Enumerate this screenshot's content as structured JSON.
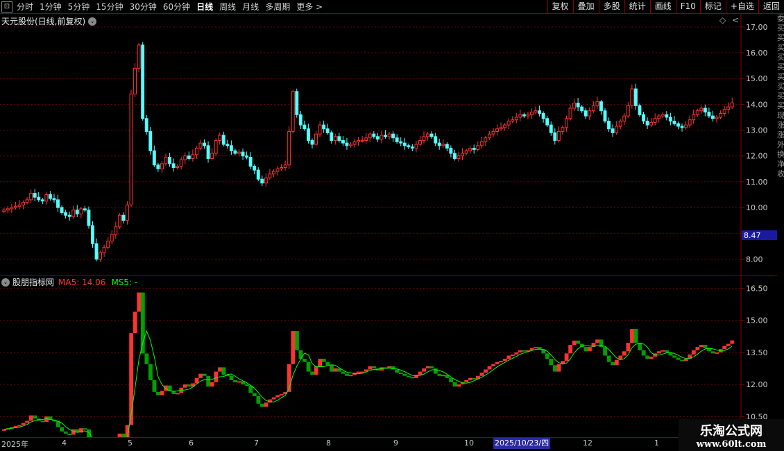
{
  "toolbar": {
    "win_icon": "⊡",
    "periods": [
      "分时",
      "1分钟",
      "5分钟",
      "15分钟",
      "30分钟",
      "60分钟",
      "日线",
      "周线",
      "月线",
      "多周期",
      "更多 >"
    ],
    "active_period": "日线",
    "tools": [
      "复权",
      "叠加",
      "多股",
      "统计",
      "画线",
      "F10",
      "标记",
      "+自选",
      "返回"
    ]
  },
  "main_panel": {
    "title": "天元股份(日线,前复权)",
    "collapse_icon": "chevron-down-icon",
    "diamond_icon": "◇",
    "scroll_icon": "<",
    "y_ticks": [
      "17.00",
      "16.00",
      "15.00",
      "14.00",
      "13.00",
      "12.00",
      "11.00",
      "10.00",
      "9.00",
      "8.00"
    ],
    "price_tag": "8.47"
  },
  "indicator_panel": {
    "title": "股朋指标网",
    "ma5_label": "MA5: 14.06",
    "ms5_label": "MS5: -",
    "y_ticks": [
      "16.50",
      "15.00",
      "13.50",
      "12.00",
      "10.50"
    ]
  },
  "side_col": {
    "text": "委买买买买买买买买买现涨涨外换净收"
  },
  "date_axis": {
    "labels": [
      "2025年",
      "4",
      "5",
      "6",
      "7",
      "8",
      "9",
      "10",
      "2025/10/23/四",
      "12",
      "1"
    ]
  },
  "watermark": {
    "title": "乐淘公式网",
    "url": "www.60lt.com"
  },
  "colors": {
    "up": "#ff3232",
    "down": "#54ffff",
    "ind_down": "#00a000",
    "ma_line": "#00ff00",
    "grid": "#7a0000",
    "axis_text": "#c8c8c8"
  },
  "chart_data": {
    "type": "candlestick",
    "ylim_main": [
      7.5,
      17.4
    ],
    "ylim_indicator": [
      9.6,
      17.0
    ],
    "closes": [
      9.9,
      9.95,
      10.0,
      10.05,
      10.1,
      10.2,
      10.3,
      10.55,
      10.4,
      10.3,
      10.25,
      10.5,
      10.35,
      10.3,
      10.0,
      9.8,
      9.7,
      9.65,
      9.9,
      9.75,
      9.95,
      9.9,
      9.3,
      8.6,
      8.0,
      8.25,
      8.45,
      8.7,
      8.95,
      9.25,
      9.7,
      9.5,
      10.1,
      14.4,
      15.4,
      16.3,
      13.45,
      12.95,
      12.2,
      11.65,
      11.5,
      11.7,
      11.95,
      11.7,
      11.55,
      11.6,
      11.85,
      12.0,
      11.9,
      12.05,
      12.3,
      12.5,
      12.4,
      11.9,
      12.1,
      12.6,
      12.8,
      12.45,
      12.4,
      12.2,
      12.1,
      12.15,
      12.0,
      11.95,
      11.6,
      11.45,
      11.1,
      10.95,
      11.15,
      11.3,
      11.4,
      11.5,
      11.55,
      11.65,
      12.95,
      14.5,
      13.6,
      13.2,
      13.05,
      12.6,
      12.45,
      12.85,
      13.2,
      13.05,
      12.9,
      12.6,
      12.75,
      12.6,
      12.5,
      12.4,
      12.45,
      12.55,
      12.6,
      12.6,
      12.7,
      12.85,
      12.75,
      12.65,
      12.8,
      12.75,
      12.85,
      12.7,
      12.55,
      12.5,
      12.4,
      12.35,
      12.3,
      12.45,
      12.6,
      12.75,
      12.85,
      12.75,
      12.5,
      12.4,
      12.45,
      12.3,
      12.1,
      11.9,
      12.0,
      12.1,
      12.2,
      12.3,
      12.25,
      12.4,
      12.55,
      12.7,
      12.85,
      12.95,
      13.05,
      13.1,
      13.2,
      13.35,
      13.4,
      13.5,
      13.6,
      13.55,
      13.6,
      13.7,
      13.75,
      13.65,
      13.45,
      13.2,
      12.9,
      12.6,
      12.95,
      13.1,
      13.45,
      13.85,
      14.05,
      13.9,
      13.75,
      13.55,
      13.75,
      13.95,
      14.1,
      13.75,
      13.35,
      13.05,
      12.9,
      13.15,
      13.35,
      13.55,
      13.95,
      14.6,
      13.95,
      13.6,
      13.35,
      13.2,
      13.3,
      13.45,
      13.55,
      13.6,
      13.5,
      13.35,
      13.25,
      13.15,
      13.1,
      13.2,
      13.4,
      13.6,
      13.75,
      13.85,
      13.7,
      13.55,
      13.45,
      13.5,
      13.65,
      13.8,
      13.9,
      14.06
    ]
  }
}
